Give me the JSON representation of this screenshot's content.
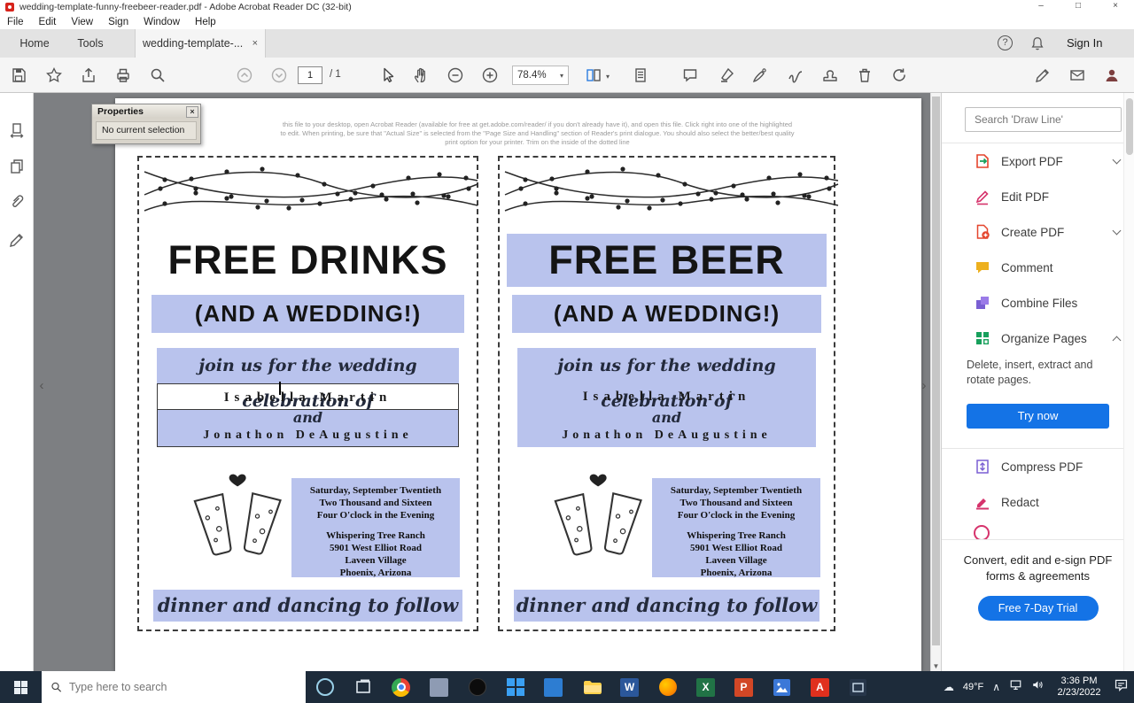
{
  "window": {
    "title": "wedding-template-funny-freebeer-reader.pdf - Adobe Acrobat Reader DC (32-bit)"
  },
  "menus": [
    "File",
    "Edit",
    "View",
    "Sign",
    "Window",
    "Help"
  ],
  "tabs": {
    "home": "Home",
    "tools": "Tools",
    "document": "wedding-template-...",
    "sign_in": "Sign In"
  },
  "toolbar": {
    "page_number": "1",
    "page_total": "/ 1",
    "zoom": "78.4%"
  },
  "properties_panel": {
    "title": "Properties",
    "message": "No current selection"
  },
  "page": {
    "instructions": [
      "this file to your desktop, open Acrobat Reader (available for free at get.adobe.com/reader/ if you don't already have it), and open this file.  Click right into one of the highlighted",
      "to edit. When printing, be sure that \"Actual Size\" is selected from the \"Page Size and Handling\" section of Reader's print dialogue. You should also select the better/best quality",
      "print option for your printer. Trim on the inside of the dotted line"
    ]
  },
  "invitations": [
    {
      "headline": "FREE DRINKS",
      "subline": "(AND A WEDDING!)",
      "intro": "join us for the wedding celebration of",
      "name1": "Isabella Martin",
      "conjunction": "and",
      "name2": "Jonathon DeAugustine",
      "when": [
        "Saturday, September Twentieth",
        "Two Thousand and Sixteen",
        "Four O'clock in the Evening"
      ],
      "where": [
        "Whispering Tree Ranch",
        "5901 West Elliot Road",
        "Laveen Village",
        "Phoenix, Arizona"
      ],
      "footer": "dinner and dancing to follow"
    },
    {
      "headline": "FREE BEER",
      "subline": "(AND A WEDDING!)",
      "intro": "join us for the wedding celebration of",
      "name1": "Isabella Martin",
      "conjunction": "and",
      "name2": "Jonathon DeAugustine",
      "when": [
        "Saturday, September Twentieth",
        "Two Thousand and Sixteen",
        "Four O'clock in the Evening"
      ],
      "where": [
        "Whispering Tree Ranch",
        "5901 West Elliot Road",
        "Laveen Village",
        "Phoenix, Arizona"
      ],
      "footer": "dinner and dancing to follow"
    }
  ],
  "right_panel": {
    "search_placeholder": "Search 'Draw Line'",
    "tools": [
      {
        "label": "Export PDF"
      },
      {
        "label": "Edit PDF"
      },
      {
        "label": "Create PDF"
      },
      {
        "label": "Comment"
      },
      {
        "label": "Combine Files"
      },
      {
        "label": "Organize Pages"
      }
    ],
    "organize_pages": {
      "description": "Delete, insert, extract and rotate pages.",
      "button": "Try now"
    },
    "more_tools": [
      {
        "label": "Compress PDF"
      },
      {
        "label": "Redact"
      }
    ],
    "promo": {
      "line1": "Convert, edit and e-sign PDF",
      "line2": "forms & agreements",
      "button": "Free 7-Day Trial"
    }
  },
  "taskbar": {
    "search_placeholder": "Type here to search",
    "weather": "49°F",
    "time": "3:36 PM",
    "date": "2/23/2022",
    "apps": {
      "word": "W",
      "excel": "X",
      "powerpoint": "P",
      "acrobat": "A"
    }
  },
  "glyphs": {
    "minimize": "–",
    "maximize": "□",
    "close": "×",
    "tab_close": "×",
    "props_close": "×",
    "help": "?",
    "caret_down": "▾",
    "scroll_down": "▼",
    "panel_collapse_left": "‹",
    "panel_expand_right": "›",
    "tray_chevron": "∧",
    "cloud": "☁"
  },
  "colors": {
    "accent_blue": "#1473e6",
    "field_highlight": "#b9c3ed"
  }
}
